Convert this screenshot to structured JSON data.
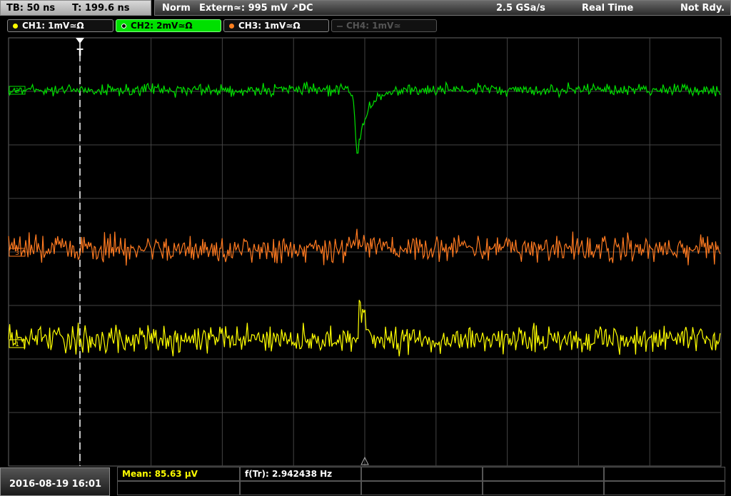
{
  "header": {
    "timebase": "TB: 50 ns",
    "trigger_time": "T: 199.6 ns",
    "acq_mode": "Norm",
    "trigger_info": "Extern≃: 995 mV ↗DC",
    "sample_rate": "2.5 GSa/s",
    "realtime": "Real Time",
    "ready_status": "Not Rdy."
  },
  "channels": [
    {
      "label": "CH1: 1mV≃Ω",
      "color": "#ffff00",
      "active": true
    },
    {
      "label": "CH2: 2mV≃Ω",
      "color": "#00e000",
      "active": true,
      "selected": true
    },
    {
      "label": "CH3: 1mV≃Ω",
      "color": "#ff8020",
      "active": true
    },
    {
      "label": "CH4: 1mV≃",
      "color": "#555555",
      "active": false
    }
  ],
  "screen": {
    "trigger_marker": "T",
    "marker_ch1": "1",
    "marker_ch2": "2",
    "marker_ch3": "3",
    "grid_color": "#444444"
  },
  "footer": {
    "datetime": "2016-08-19 16:01",
    "mean": "Mean: 85.63 µV",
    "freq": "f(Tr): 2.942438 Hz"
  }
}
